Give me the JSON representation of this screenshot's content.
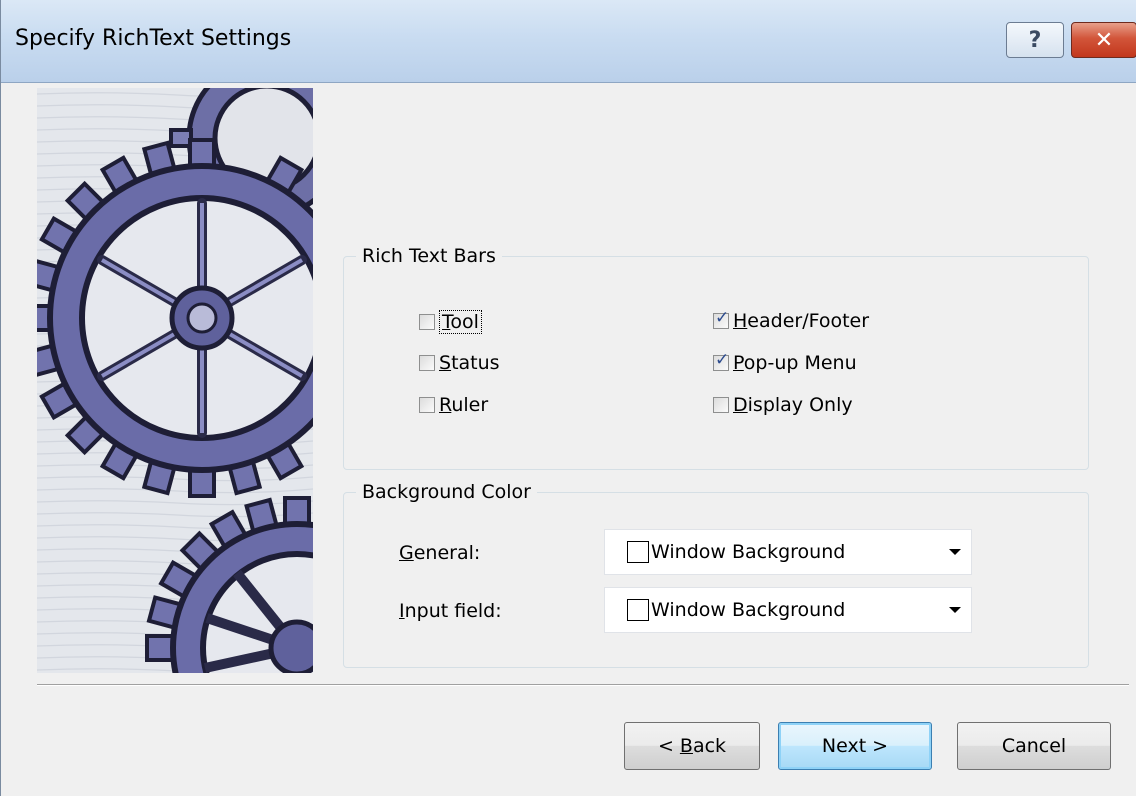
{
  "window": {
    "title": "Specify RichText Settings",
    "help_label": "?",
    "close_label": "✕"
  },
  "rich_text_bars": {
    "legend": "Rich Text Bars",
    "items": [
      {
        "label": "Tool",
        "mnemonic": "T",
        "rest": "ool",
        "checked": false
      },
      {
        "label": "Status",
        "mnemonic": "S",
        "rest": "tatus",
        "checked": false
      },
      {
        "label": "Ruler",
        "mnemonic": "R",
        "rest": "uler",
        "checked": false
      },
      {
        "label": "Header/Footer",
        "mnemonic": "H",
        "rest": "eader/Footer",
        "checked": true
      },
      {
        "label": "Pop-up Menu",
        "mnemonic": "P",
        "rest": "op-up Menu",
        "checked": true
      },
      {
        "label": "Display Only",
        "mnemonic": "D",
        "rest": "isplay Only",
        "checked": false
      }
    ]
  },
  "background_color": {
    "legend": "Background Color",
    "general": {
      "label_mnemonic": "G",
      "label_rest": "eneral:",
      "value": "Window Background"
    },
    "input_field": {
      "label_mnemonic": "I",
      "label_rest": "nput field:",
      "value": "Window Background"
    }
  },
  "buttons": {
    "back_prefix": "< ",
    "back_mnemonic": "B",
    "back_rest": "ack",
    "next": "Next >",
    "cancel": "Cancel"
  },
  "colors": {
    "title_bar": "#c9dcf1",
    "close_button": "#c2371c",
    "checkmark": "#2c4b8e",
    "gear_art": "#5b5f9a"
  },
  "icons": {
    "help": "help-icon",
    "close": "close-icon",
    "dropdown": "chevron-down-icon",
    "art": "gears-illustration"
  }
}
